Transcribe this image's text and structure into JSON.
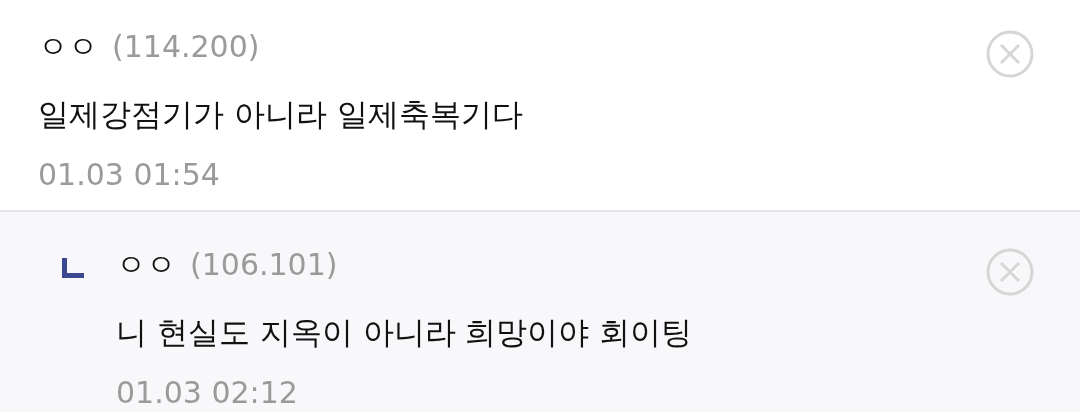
{
  "comments": [
    {
      "kind": "comment",
      "author": "ㅇㅇ",
      "ip": "(114.200)",
      "text": "일제강점기가 아니라 일제축복기다",
      "date": "01.03 01:54"
    },
    {
      "kind": "reply",
      "author": "ㅇㅇ",
      "ip": "(106.101)",
      "text": "니 현실도 지옥이 아니라 희망이야 회이팅",
      "date": "01.03 02:12"
    }
  ]
}
